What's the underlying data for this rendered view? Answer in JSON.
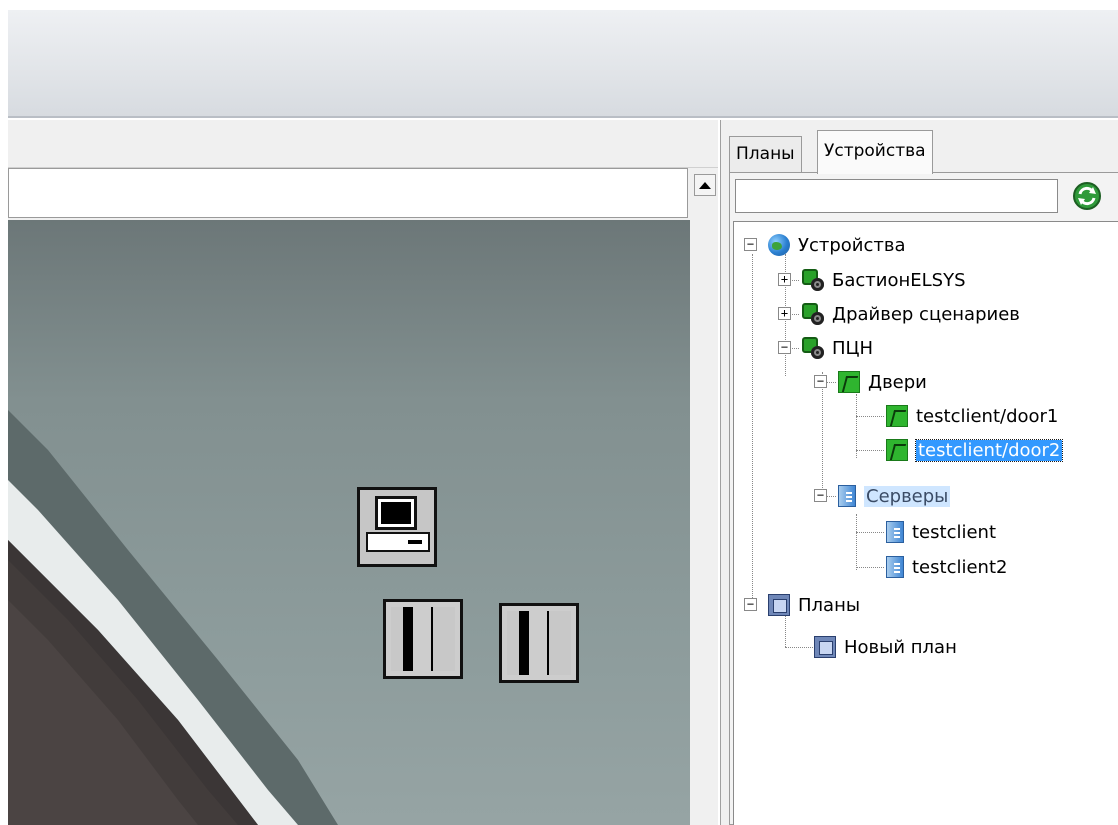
{
  "right_panel": {
    "tabs": [
      {
        "label": "Планы"
      },
      {
        "label": "Устройства"
      }
    ],
    "search": {
      "value": ""
    },
    "tree": {
      "root": "Устройства",
      "items": [
        {
          "label": "БастионELSYS"
        },
        {
          "label": "Драйвер сценариев"
        },
        {
          "label": "ПЦН"
        },
        {
          "label": "Двери"
        },
        {
          "label": "testclient/door1"
        },
        {
          "label": "testclient/door2"
        },
        {
          "label": "Серверы"
        },
        {
          "label": "testclient"
        },
        {
          "label": "testclient2"
        }
      ],
      "plans_root": "Планы",
      "plan_item": "Новый план"
    }
  },
  "canvas": {
    "objects": [
      {
        "name": "computer-icon"
      },
      {
        "name": "door-icon"
      },
      {
        "name": "door-icon"
      }
    ]
  },
  "colors": {
    "selection": "#3399ff",
    "highlight": "#cfe6ff",
    "canvas_bg": "#8d9c9c"
  }
}
